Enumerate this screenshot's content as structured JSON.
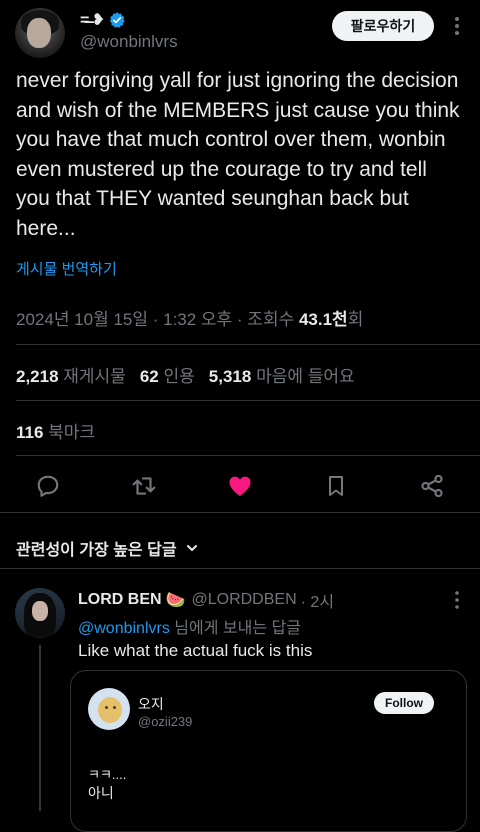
{
  "author": {
    "name_glyphs": "=̶̶ ❥",
    "handle": "@wonbinlvrs",
    "verified": true,
    "follow_label": "팔로우하기"
  },
  "tweet": {
    "text": "never forgiving yall for just ignoring the decision and wish of the MEMBERS just cause you think you have that much control over them, wonbin even mustered up the courage to try and tell you that THEY wanted seunghan back but here...",
    "translate_label": "게시물 번역하기",
    "timestamp": "2024년 10월 15일 · 1:32 오후 · 조회수 ",
    "views": "43.1천",
    "views_suffix": "회"
  },
  "stats": {
    "reposts": "2,218",
    "reposts_label": "재게시물",
    "quotes": "62",
    "quotes_label": "인용",
    "likes": "5,318",
    "likes_label": "마음에 들어요",
    "bookmarks": "116",
    "bookmarks_label": "북마크"
  },
  "actions": {
    "icons": [
      "reply-icon",
      "repost-icon",
      "like-icon",
      "bookmark-icon",
      "share-icon"
    ],
    "like_color": "#f91880",
    "icon_color": "#71767b"
  },
  "sort": {
    "label": "관련성이 가장 높은 답글"
  },
  "reply": {
    "name": "LORD BEN",
    "emoji": "🍉",
    "handle": "@LORDDBEN",
    "time": " · 2시",
    "replying_mention": "@wonbinlvrs",
    "replying_suffix": " 님에게 보내는 답글",
    "text": "Like what the actual fuck is this"
  },
  "quoted": {
    "name": "오지",
    "handle": "@ozii239",
    "follow_label": "Follow",
    "line1": "ㅋㅋ....",
    "line2": "아니"
  },
  "colors": {
    "background": "#000000",
    "text": "#e7e9ea",
    "muted": "#71767b",
    "link": "#1d9bf0",
    "verified": "#1d9bf0",
    "divider": "#2f3336"
  }
}
